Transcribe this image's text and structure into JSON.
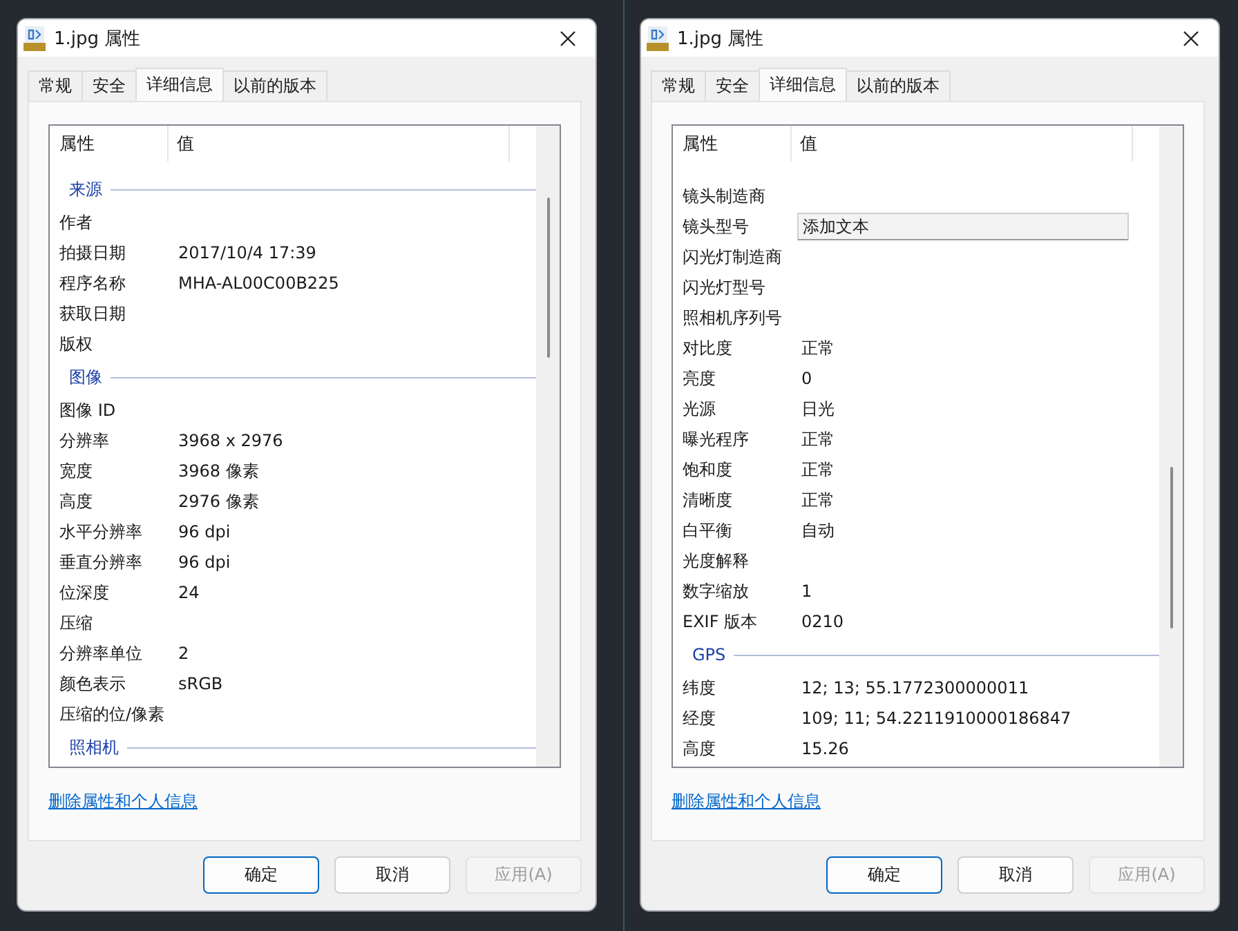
{
  "dialogs": [
    {
      "title": "1.jpg 属性",
      "scrolled": false,
      "tabs": [
        {
          "label": "常规",
          "selected": false
        },
        {
          "label": "安全",
          "selected": false
        },
        {
          "label": "详细信息",
          "selected": true
        },
        {
          "label": "以前的版本",
          "selected": false
        }
      ],
      "columns": [
        "属性",
        "值"
      ],
      "rows": [
        {
          "kind": "group",
          "label": "来源"
        },
        {
          "kind": "prop",
          "name": "作者"
        },
        {
          "kind": "prop",
          "name": "拍摄日期",
          "value": "2017/10/4 17:39"
        },
        {
          "kind": "prop",
          "name": "程序名称",
          "value": "MHA-AL00C00B225"
        },
        {
          "kind": "prop",
          "name": "获取日期"
        },
        {
          "kind": "prop",
          "name": "版权"
        },
        {
          "kind": "group",
          "label": "图像"
        },
        {
          "kind": "prop",
          "name": "图像 ID"
        },
        {
          "kind": "prop",
          "name": "分辨率",
          "value": "3968 x 2976"
        },
        {
          "kind": "prop",
          "name": "宽度",
          "value": "3968 像素"
        },
        {
          "kind": "prop",
          "name": "高度",
          "value": "2976 像素"
        },
        {
          "kind": "prop",
          "name": "水平分辨率",
          "value": "96 dpi"
        },
        {
          "kind": "prop",
          "name": "垂直分辨率",
          "value": "96 dpi"
        },
        {
          "kind": "prop",
          "name": "位深度",
          "value": "24"
        },
        {
          "kind": "prop",
          "name": "压缩"
        },
        {
          "kind": "prop",
          "name": "分辨率单位",
          "value": "2"
        },
        {
          "kind": "prop",
          "name": "颜色表示",
          "value": "sRGB"
        },
        {
          "kind": "prop",
          "name": "压缩的位/像素"
        },
        {
          "kind": "group",
          "label": "照相机"
        }
      ],
      "link": "删除属性和个人信息",
      "buttons": [
        {
          "label": "确定",
          "default": true,
          "disabled": false
        },
        {
          "label": "取消",
          "default": false,
          "disabled": false
        },
        {
          "label": "应用(A)",
          "default": false,
          "disabled": true
        }
      ]
    },
    {
      "title": "1.jpg 属性",
      "scrolled": true,
      "tabs": [
        {
          "label": "常规",
          "selected": false
        },
        {
          "label": "安全",
          "selected": false
        },
        {
          "label": "详细信息",
          "selected": true
        },
        {
          "label": "以前的版本",
          "selected": false
        }
      ],
      "columns": [
        "属性",
        "值"
      ],
      "rows": [
        {
          "kind": "prop",
          "name": "镜头制造商"
        },
        {
          "kind": "field",
          "name": "镜头型号",
          "placeholder": "添加文本"
        },
        {
          "kind": "prop",
          "name": "闪光灯制造商"
        },
        {
          "kind": "prop",
          "name": "闪光灯型号"
        },
        {
          "kind": "prop",
          "name": "照相机序列号"
        },
        {
          "kind": "prop",
          "name": "对比度",
          "value": "正常"
        },
        {
          "kind": "prop",
          "name": "亮度",
          "value": "0"
        },
        {
          "kind": "prop",
          "name": "光源",
          "value": "日光"
        },
        {
          "kind": "prop",
          "name": "曝光程序",
          "value": "正常"
        },
        {
          "kind": "prop",
          "name": "饱和度",
          "value": "正常"
        },
        {
          "kind": "prop",
          "name": "清晰度",
          "value": "正常"
        },
        {
          "kind": "prop",
          "name": "白平衡",
          "value": "自动"
        },
        {
          "kind": "prop",
          "name": "光度解释"
        },
        {
          "kind": "prop",
          "name": "数字缩放",
          "value": "1"
        },
        {
          "kind": "prop",
          "name": "EXIF 版本",
          "value": "0210"
        },
        {
          "kind": "group",
          "label": "GPS"
        },
        {
          "kind": "prop",
          "name": "纬度",
          "value": "12; 13; 55.1772300000011"
        },
        {
          "kind": "prop",
          "name": "经度",
          "value": "109; 11; 54.2211910000186847"
        },
        {
          "kind": "prop",
          "name": "高度",
          "value": "15.26"
        }
      ],
      "link": "删除属性和个人信息",
      "buttons": [
        {
          "label": "确定",
          "default": true,
          "disabled": false
        },
        {
          "label": "取消",
          "default": false,
          "disabled": false
        },
        {
          "label": "应用(A)",
          "default": false,
          "disabled": true
        }
      ]
    }
  ]
}
